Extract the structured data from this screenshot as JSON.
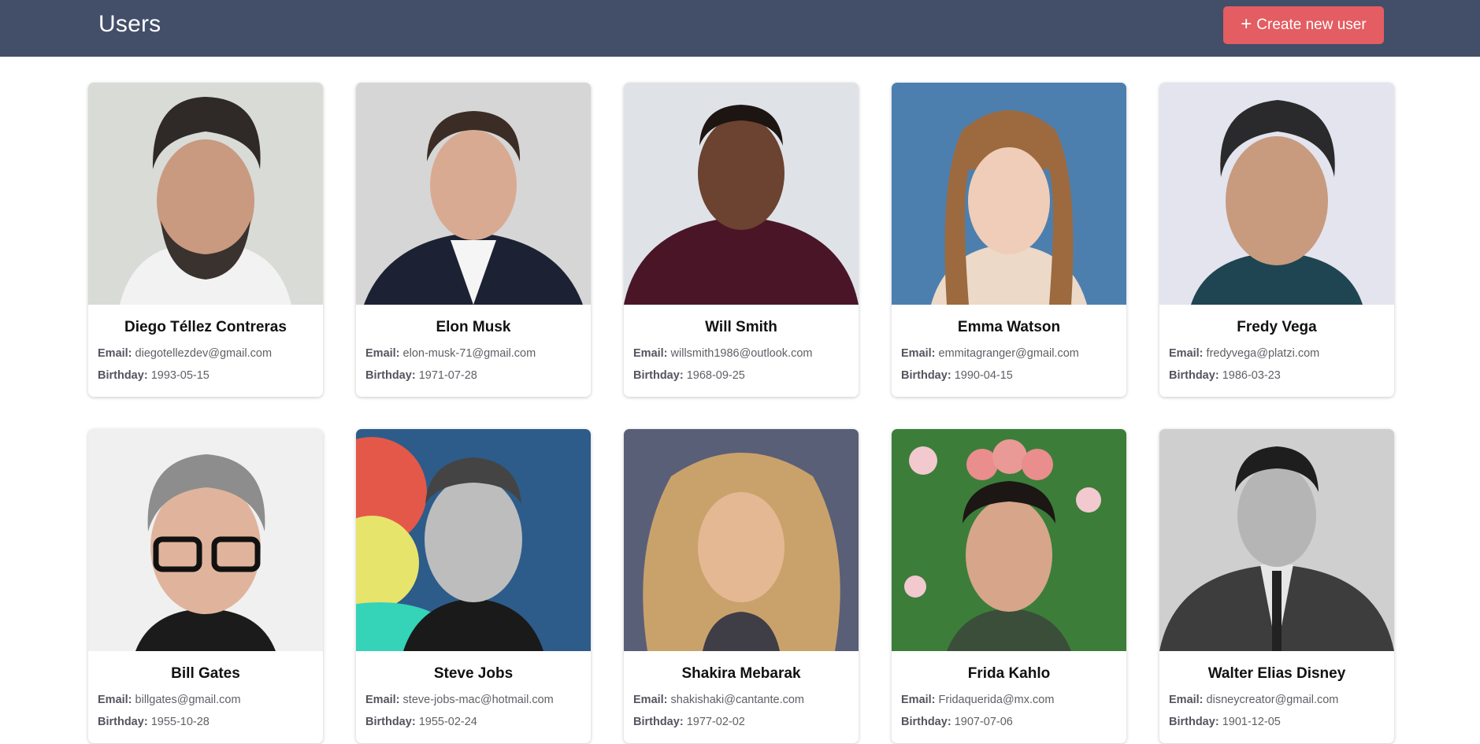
{
  "header": {
    "title": "Users",
    "create_button": "Create new user",
    "plus_icon": "+"
  },
  "labels": {
    "email": "Email:",
    "birthday": "Birthday:"
  },
  "colors": {
    "header_bg": "#434e69",
    "create_button_bg": "#e35d62"
  },
  "users": [
    {
      "name": "Diego Téllez Contreras",
      "email": "diegotellezdev@gmail.com",
      "birthday": "1993-05-15"
    },
    {
      "name": "Elon Musk",
      "email": "elon-musk-71@gmail.com",
      "birthday": "1971-07-28"
    },
    {
      "name": "Will Smith",
      "email": "willsmith1986@outlook.com",
      "birthday": "1968-09-25"
    },
    {
      "name": "Emma Watson",
      "email": "emmitagranger@gmail.com",
      "birthday": "1990-04-15"
    },
    {
      "name": "Fredy Vega",
      "email": "fredyvega@platzi.com",
      "birthday": "1986-03-23"
    },
    {
      "name": "Bill Gates",
      "email": "billgates@gmail.com",
      "birthday": "1955-10-28"
    },
    {
      "name": "Steve Jobs",
      "email": "steve-jobs-mac@hotmail.com",
      "birthday": "1955-02-24"
    },
    {
      "name": "Shakira Mebarak",
      "email": "shakishaki@cantante.com",
      "birthday": "1977-02-02"
    },
    {
      "name": "Frida Kahlo",
      "email": "Fridaquerida@mx.com",
      "birthday": "1907-07-06"
    },
    {
      "name": "Walter Elias Disney",
      "email": "disneycreator@gmail.com",
      "birthday": "1901-12-05"
    }
  ]
}
